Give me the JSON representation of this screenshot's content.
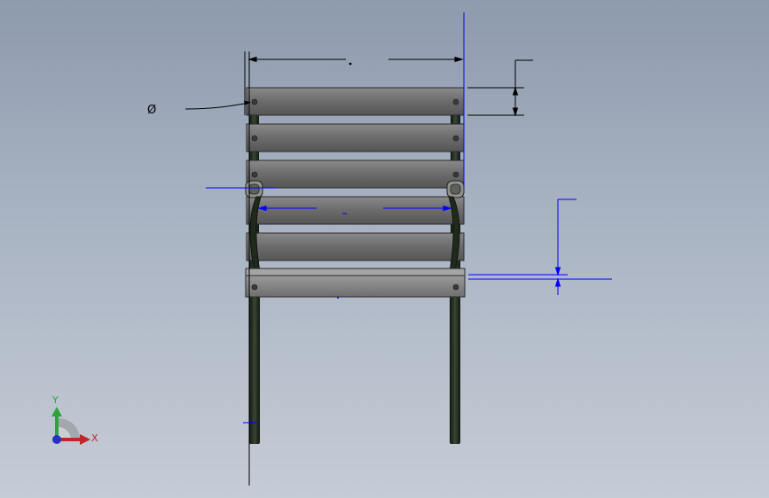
{
  "drawing": {
    "view": "front",
    "part": "chair",
    "diameter_symbol": "Ø"
  },
  "triad": {
    "y_label": "Y",
    "x_label": "X",
    "x_color": "#c0262a",
    "y_color": "#2fa33a",
    "z_color": "#2433c6"
  },
  "colors": {
    "slat_fill": "#6b6b6b",
    "frame_fill": "#1f2a1c",
    "dimension_black": "#000000",
    "dimension_blue": "#0000ff"
  }
}
